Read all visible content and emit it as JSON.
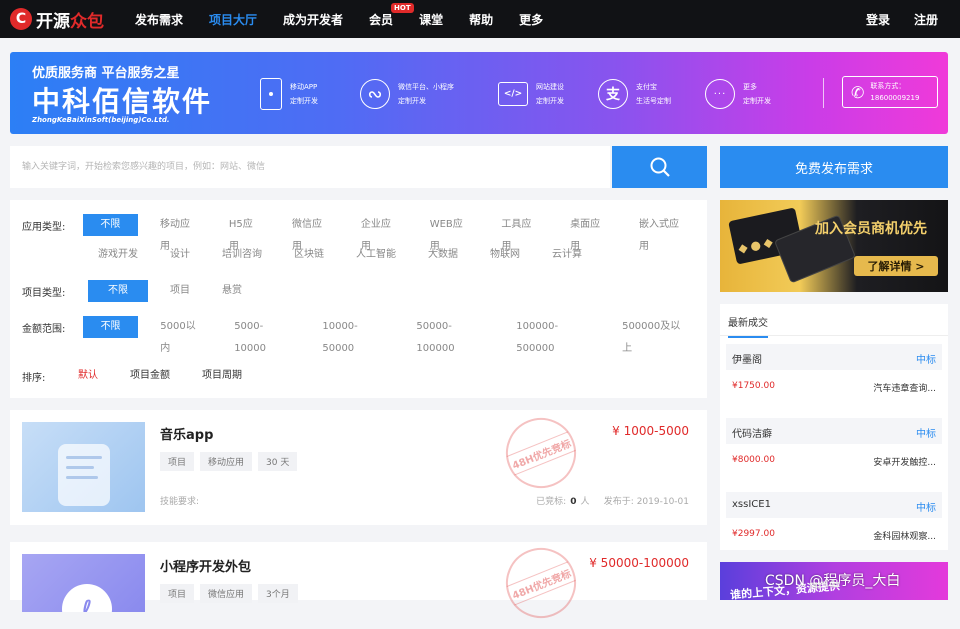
{
  "nav": {
    "logo_1": "开源",
    "logo_2": "众包",
    "items": [
      {
        "label": "发布需求"
      },
      {
        "label": "项目大厅"
      },
      {
        "label": "成为开发者"
      },
      {
        "label": "会员",
        "badge": "HOT"
      },
      {
        "label": "课堂"
      },
      {
        "label": "帮助"
      },
      {
        "label": "更多"
      }
    ],
    "login": "登录",
    "register": "注册"
  },
  "banner": {
    "slogan": "优质服务商 平台服务之星",
    "company": "中科佰信软件",
    "company_en": "ZhongKeBaiXinSoft(beijing)Co.Ltd.",
    "services": [
      {
        "line1": "移动APP",
        "line2": "定制开发"
      },
      {
        "line1": "微信平台、小程序",
        "line2": "定制开发"
      },
      {
        "line1": "网站建设",
        "line2": "定制开发"
      },
      {
        "line1": "支付宝",
        "line2": "生活号定制"
      },
      {
        "line1": "更多",
        "line2": "定制开发"
      }
    ],
    "contact_label": "联系方式：",
    "contact_phone": "18600009219"
  },
  "search": {
    "placeholder": "输入关键字词，开始检索您感兴趣的项目，例如：网站、微信",
    "post_label": "免费发布需求"
  },
  "filters": {
    "app_type": {
      "label": "应用类型:",
      "options": [
        "不限",
        "移动应用",
        "H5应用",
        "微信应用",
        "企业应用",
        "WEB应用",
        "工具应用",
        "桌面应用",
        "嵌入式应用",
        "游戏开发",
        "设计",
        "培训咨询",
        "区块链",
        "人工智能",
        "大数据",
        "物联网",
        "云计算"
      ]
    },
    "project_type": {
      "label": "项目类型:",
      "options": [
        "不限",
        "项目",
        "悬赏"
      ]
    },
    "amount": {
      "label": "金额范围:",
      "options": [
        "不限",
        "5000以内",
        "5000-10000",
        "10000-50000",
        "50000-100000",
        "100000-500000",
        "500000及以上"
      ]
    },
    "sort": {
      "label": "排序:",
      "options": [
        "默认",
        "项目金额",
        "项目周期"
      ]
    }
  },
  "projects": [
    {
      "title": "音乐app",
      "tags": [
        "项目",
        "移动应用",
        "30 天"
      ],
      "skills": "技能要求:",
      "price": "¥ 1000-5000",
      "stamp": "48H优先竞标",
      "bids_label": "已竞标:",
      "bids": "0",
      "bids_unit": "人",
      "posted": "发布于: 2019-10-01"
    },
    {
      "title": "小程序开发外包",
      "tags": [
        "项目",
        "微信应用",
        "3个月"
      ],
      "price": "¥ 50000-100000",
      "stamp": "48H优先竞标"
    }
  ],
  "vip": {
    "title": "加入会员商机优先",
    "button": "了解详情 >"
  },
  "deals": {
    "heading": "最新成交",
    "items": [
      {
        "name": "伊墨阁",
        "status": "中标",
        "price": "¥1750.00",
        "project": "汽车违章查询..."
      },
      {
        "name": "代码洁癖",
        "status": "中标",
        "price": "¥8000.00",
        "project": "安卓开发触控..."
      },
      {
        "name": "xssICE1",
        "status": "中标",
        "price": "¥2997.00",
        "project": "金科园林观察..."
      }
    ]
  },
  "ad": {
    "text": "谁的上下文，资源提供"
  },
  "watermark": "CSDN @程序员_大白"
}
